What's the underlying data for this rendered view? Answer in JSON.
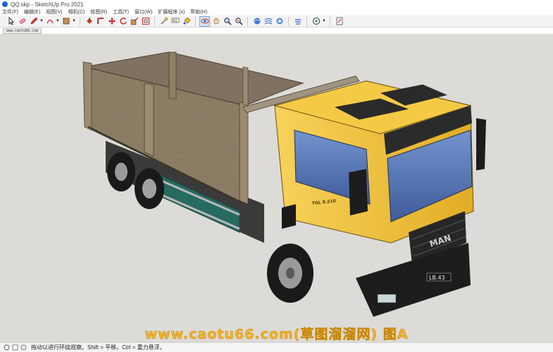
{
  "window": {
    "title": "QQ.skp - SketchUp Pro 2021"
  },
  "menu": [
    "文件(F)",
    "编辑(E)",
    "视图(V)",
    "相机(C)",
    "绘图(R)",
    "工具(T)",
    "窗口(W)",
    "扩展程序 (x)",
    "帮助(H)"
  ],
  "scene": {
    "tab_label": "www.caotu66.com"
  },
  "toolbar": {
    "icons": [
      "select-icon",
      "eraser-icon",
      "pencil-icon",
      "arc-icon",
      "rectangle-icon",
      "push-pull-icon",
      "follow-me-icon",
      "move-icon",
      "rotate-icon",
      "scale-icon",
      "offset-icon",
      "tape-measure-icon",
      "text-icon",
      "paint-bucket-icon",
      "orbit-icon",
      "pan-icon",
      "zoom-icon",
      "zoom-extents-icon",
      "sandbox-icon",
      "photo-texture-icon",
      "section-icon",
      "geo-location-icon",
      "3d-warehouse-icon",
      "extension-warehouse-icon",
      "layout-icon"
    ]
  },
  "watermark": {
    "text": "www.caotu66.com(草图溜溜网) 图A"
  },
  "truck": {
    "door_text": "TGL 8.210",
    "grille_brand": "MAN",
    "plate": "LB.43"
  },
  "status": {
    "text": "拖动以进行环绕观察。Shift = 平移。Ctrl = 重力悬浮。"
  },
  "colors": {
    "cab": "#f2c437",
    "bed": "#8e8067",
    "glass": "#5b79b6",
    "viewport_bg": "#dcdbd7",
    "watermark": "#f1b22e"
  }
}
